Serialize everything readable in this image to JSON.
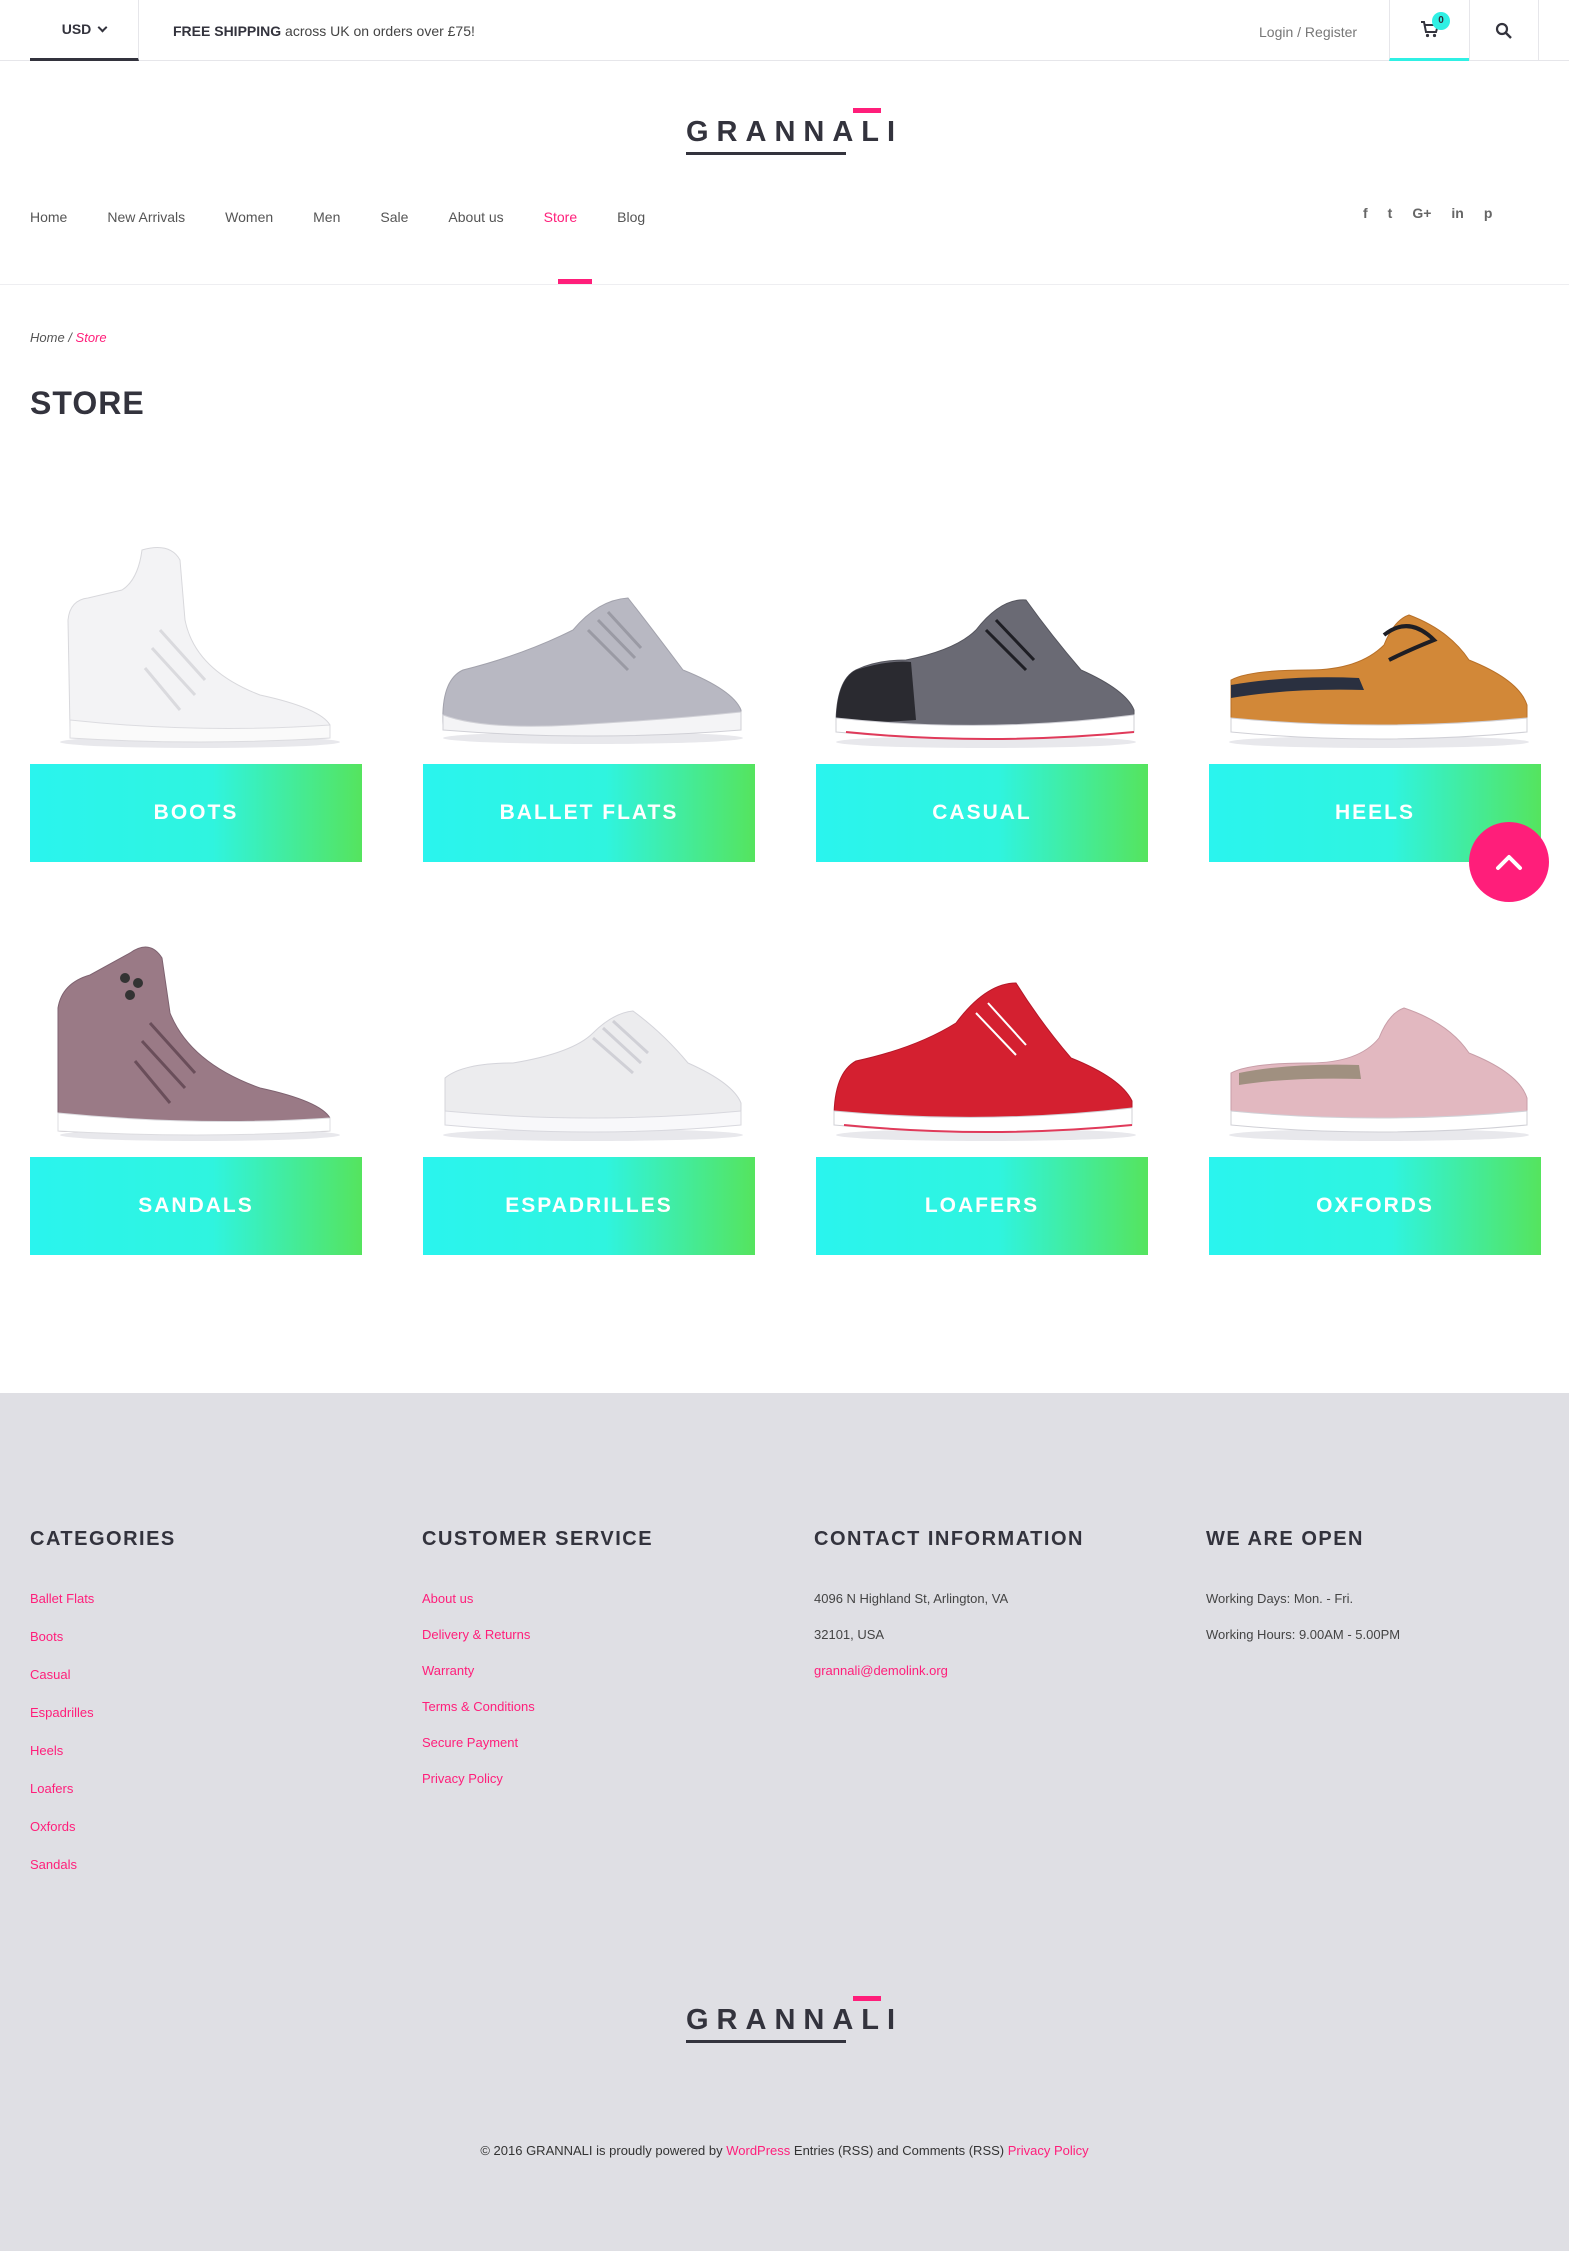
{
  "topbar": {
    "currency": "USD",
    "shipping_bold": "FREE SHIPPING",
    "shipping_text": " across UK on orders over £75!",
    "login": "Login / Register",
    "cart_count": "0"
  },
  "logo": {
    "text": "GRANNALI"
  },
  "nav": {
    "items": [
      "Home",
      "New Arrivals",
      "Women",
      "Men",
      "Sale",
      "About us",
      "Store",
      "Blog"
    ],
    "active": "Store"
  },
  "social": [
    "f",
    "t",
    "G+",
    "in",
    "p"
  ],
  "breadcrumb": {
    "home": "Home",
    "sep": " / ",
    "current": "Store"
  },
  "page_title": "STORE",
  "categories": [
    {
      "label": "BOOTS",
      "shoe": "white-hightop"
    },
    {
      "label": "BALLET FLATS",
      "shoe": "grey-runner"
    },
    {
      "label": "CASUAL",
      "shoe": "black-grey-runner"
    },
    {
      "label": "HEELS",
      "shoe": "tan-slipon"
    },
    {
      "label": "SANDALS",
      "shoe": "rose-gold-hightop"
    },
    {
      "label": "ESPADRILLES",
      "shoe": "white-lowtop"
    },
    {
      "label": "LOAFERS",
      "shoe": "red-runner"
    },
    {
      "label": "OXFORDS",
      "shoe": "pink-slipon"
    }
  ],
  "colors": {
    "accent": "#ff1e7a",
    "teal": "#2ff0e4",
    "green": "#55e45e",
    "dark": "#33333d"
  },
  "footer": {
    "categories": {
      "title": "CATEGORIES",
      "links": [
        "Ballet Flats",
        "Boots",
        "Casual",
        "Espadrilles",
        "Heels",
        "Loafers",
        "Oxfords",
        "Sandals"
      ]
    },
    "customer_service": {
      "title": "CUSTOMER SERVICE",
      "links": [
        "About us",
        "Delivery & Returns",
        "Warranty",
        "Terms & Conditions",
        "Secure Payment",
        "Privacy Policy"
      ]
    },
    "contact": {
      "title": "CONTACT INFORMATION",
      "address1": "4096 N Highland St, Arlington, VA",
      "address2": "32101, USA",
      "email": "grannali@demolink.org"
    },
    "open": {
      "title": "WE ARE OPEN",
      "days": "Working Days: Mon. - Fri.",
      "hours": "Working Hours: 9.00AM - 5.00PM"
    },
    "copyright": {
      "part1": "© 2016 GRANNALI is proudly powered by ",
      "wordpress": "WordPress",
      "part2": " Entries (RSS) and Comments (RSS) ",
      "privacy": "Privacy Policy"
    }
  }
}
